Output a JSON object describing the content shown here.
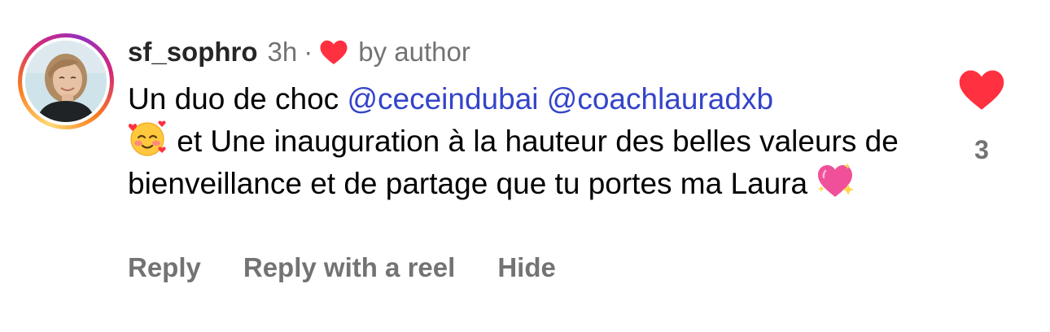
{
  "colors": {
    "heart": "#ff3040",
    "mention": "#3444c9",
    "secondary_text": "#737373",
    "username_text": "#262626"
  },
  "comment": {
    "username": "sf_sophro",
    "time": "3h",
    "separator": "·",
    "liked_by_author_icon": "heart-icon",
    "liked_by_author_label": "by author",
    "body": {
      "text_1": "Un duo de choc ",
      "mention_1": "@ceceindubai",
      "text_2": " ",
      "mention_2": "@coachlauradxb",
      "emoji_1": "smiling-face-with-hearts-emoji",
      "text_3": " et Une inauguration à la hauteur des belles valeurs de bienveillance et de partage que tu portes ma Laura ",
      "emoji_2": "sparkling-heart-emoji"
    },
    "actions": {
      "reply": "Reply",
      "reply_with_reel": "Reply with a reel",
      "hide": "Hide"
    },
    "like": {
      "icon": "heart-icon",
      "count": "3"
    }
  }
}
